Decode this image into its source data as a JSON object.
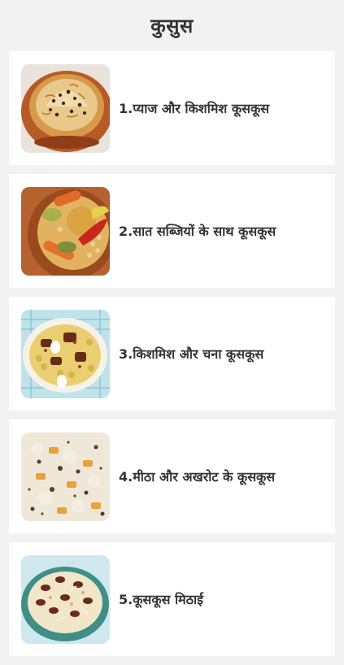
{
  "header": {
    "title": "कुसुस"
  },
  "recipes": [
    {
      "label": "1.प्याज और किशमिश कूसकूस",
      "image": "couscous-onion-raisin-image"
    },
    {
      "label": "2.सात सब्जियों के साथ कूसकूस",
      "image": "couscous-seven-vegetables-image"
    },
    {
      "label": "3.किशमिश और चना कूसकूस",
      "image": "couscous-raisin-chickpea-image"
    },
    {
      "label": "4.मीठा और अखरोट के कूसकूस",
      "image": "couscous-sweet-walnut-image"
    },
    {
      "label": "5.कूसकूस मिठाई",
      "image": "couscous-dessert-image"
    }
  ]
}
